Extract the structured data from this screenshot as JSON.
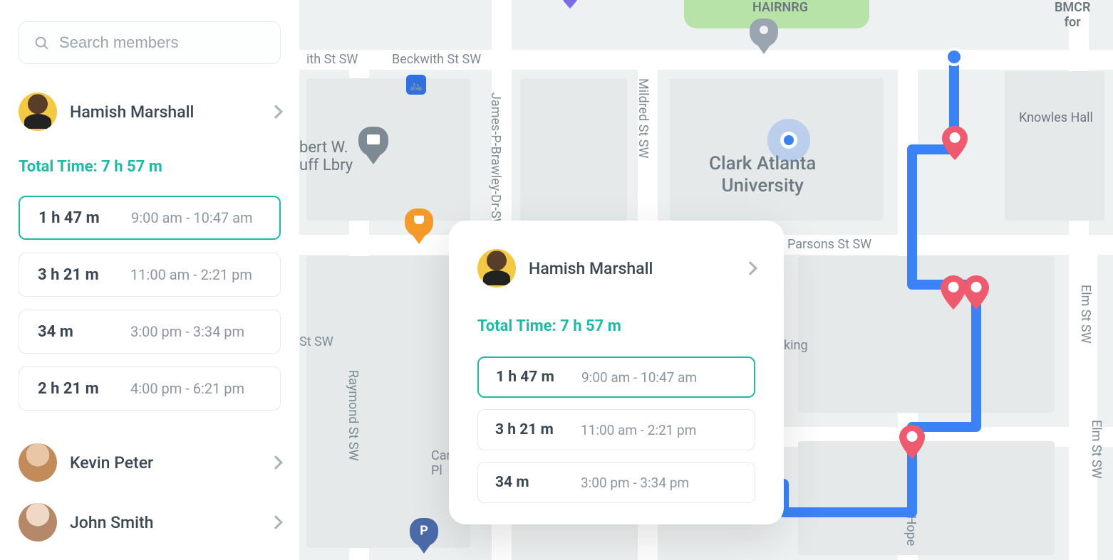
{
  "search": {
    "placeholder": "Search members"
  },
  "selected_member": {
    "name": "Hamish Marshall"
  },
  "total_time_label": "Total Time: 7 h 57 m",
  "segments": [
    {
      "duration": "1 h 47 m",
      "range": "9:00 am - 10:47 am",
      "active": true
    },
    {
      "duration": "3 h 21 m",
      "range": "11:00 am - 2:21 pm",
      "active": false
    },
    {
      "duration": "34 m",
      "range": "3:00 pm - 3:34 pm",
      "active": false
    },
    {
      "duration": "2 h 21 m",
      "range": "4:00 pm - 6:21 pm",
      "active": false
    }
  ],
  "other_members": [
    {
      "name": "Kevin Peter"
    },
    {
      "name": "John Smith"
    }
  ],
  "overlay": {
    "member": {
      "name": "Hamish Marshall"
    },
    "total_time_label": "Total Time: 7 h 57 m",
    "segments": [
      {
        "duration": "1 h 47 m",
        "range": "9:00 am - 10:47 am",
        "active": true
      },
      {
        "duration": "3 h 21 m",
        "range": "11:00 am - 2:21 pm",
        "active": false
      },
      {
        "duration": "34 m",
        "range": "3:00 pm - 3:34 pm",
        "active": false
      }
    ]
  },
  "map_labels": {
    "beckwith": "Beckwith St SW",
    "ith_sw": "ith St SW",
    "brawley": "James-P-Brawley-Dr-SW",
    "mildred": "Mildred St SW",
    "parsons": "Parsons St SW",
    "elm1": "Elm St SW",
    "elm2": "Elm St SW",
    "raymond": "Raymond St SW",
    "st_sw": "St SW",
    "john_hope": "John Hope",
    "car_pl": "Care\nPl",
    "king": "king",
    "hairnrg": "HAIRNRG",
    "bmcr": "BMCR\nfor",
    "knowles": "Knowles Hall",
    "cau": "Clark Atlanta\nUniversity",
    "lbry": "bert W.\nuff Lbry"
  },
  "colors": {
    "accent": "#20b9a5",
    "route": "#3b82f6",
    "pin": "#ef5b6e"
  }
}
